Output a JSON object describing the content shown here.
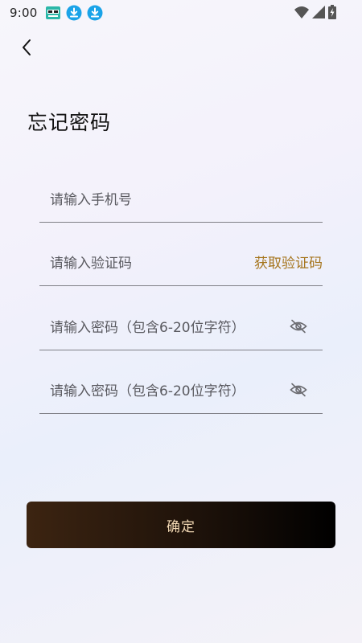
{
  "status_bar": {
    "time": "9:00",
    "icons_left": [
      "app-notification-icon",
      "download-icon",
      "download-icon"
    ],
    "icons_right": [
      "wifi-icon",
      "cellular-signal-icon",
      "battery-charging-icon"
    ]
  },
  "header": {
    "back_icon": "chevron-left-icon",
    "title": "忘记密码"
  },
  "form": {
    "phone": {
      "placeholder": "请输入手机号",
      "value": ""
    },
    "code": {
      "placeholder": "请输入验证码",
      "value": "",
      "get_code_label": "获取验证码"
    },
    "password": {
      "placeholder": "请输入密码（包含6-20位字符）",
      "value": "",
      "toggle_icon": "eye-off-icon"
    },
    "password_confirm": {
      "placeholder": "请输入密码（包含6-20位字符）",
      "value": "",
      "toggle_icon": "eye-off-icon"
    }
  },
  "confirm_button": {
    "label": "确定"
  },
  "colors": {
    "accent": "#a5741c",
    "button_start": "#3c2411",
    "button_end": "#000000",
    "button_text": "#f3d9b4",
    "download_icon": "#1aa3e8"
  }
}
